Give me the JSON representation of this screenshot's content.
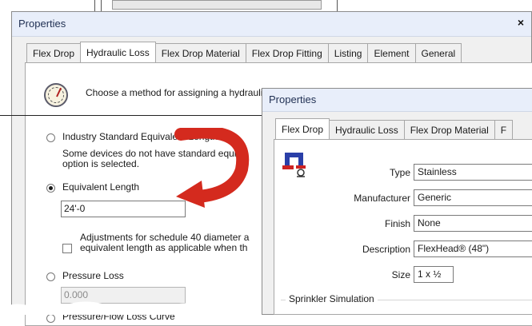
{
  "window1": {
    "title": "Properties",
    "close_label": "×",
    "tabs": [
      "Flex Drop",
      "Hydraulic Loss",
      "Flex Drop Material",
      "Flex Drop Fitting",
      "Listing",
      "Element",
      "General"
    ],
    "choose_text": "Choose a method for assigning a hydraulic loss to this device.",
    "option_industry": "Industry Standard Equivalent Length",
    "industry_note_line1": "Some devices do not have standard equi",
    "industry_note_line2": "option is selected.",
    "option_equivalent": "Equivalent Length",
    "equivalent_value": "24'-0",
    "adjust_line1": "Adjustments for schedule 40 diameter a",
    "adjust_line2": "equivalent length as applicable when th",
    "option_pressure": "Pressure Loss",
    "pressure_value": "0.000",
    "option_curve": "Pressure/Flow Loss Curve"
  },
  "window2": {
    "title": "Properties",
    "tabs": [
      "Flex Drop",
      "Hydraulic Loss",
      "Flex Drop Material",
      "F"
    ],
    "fields": [
      {
        "label": "Type",
        "value": "Stainless"
      },
      {
        "label": "Manufacturer",
        "value": "Generic"
      },
      {
        "label": "Finish",
        "value": "None"
      },
      {
        "label": "Description",
        "value": "FlexHead® (48\")"
      },
      {
        "label": "Size",
        "value": "1 x ½"
      }
    ],
    "group_title": "Sprinkler Simulation"
  },
  "colors": {
    "titlebar": "#e8eefa",
    "arrow": "#d42a1e",
    "sprinkler_icon": "#2a3fa8"
  }
}
